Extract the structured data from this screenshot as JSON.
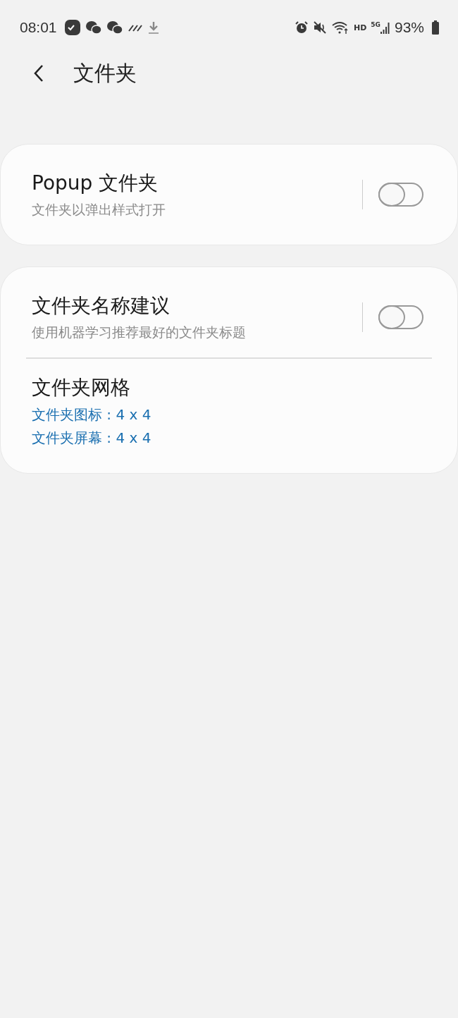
{
  "status_bar": {
    "time": "08:01",
    "network_label": "HD",
    "signal_label": "5G",
    "battery": "93%"
  },
  "header": {
    "title": "文件夹"
  },
  "groups": [
    {
      "items": [
        {
          "kind": "switch",
          "title": "Popup 文件夹",
          "summary": "文件夹以弹出样式打开",
          "on": false
        }
      ]
    },
    {
      "items": [
        {
          "kind": "switch",
          "title": "文件夹名称建议",
          "summary": "使用机器学习推荐最好的文件夹标题",
          "on": false
        },
        {
          "kind": "info",
          "title": "文件夹网格",
          "lines": [
            "文件夹图标 : 4 x 4",
            "文件夹屏幕 : 4 x 4"
          ]
        }
      ]
    }
  ]
}
